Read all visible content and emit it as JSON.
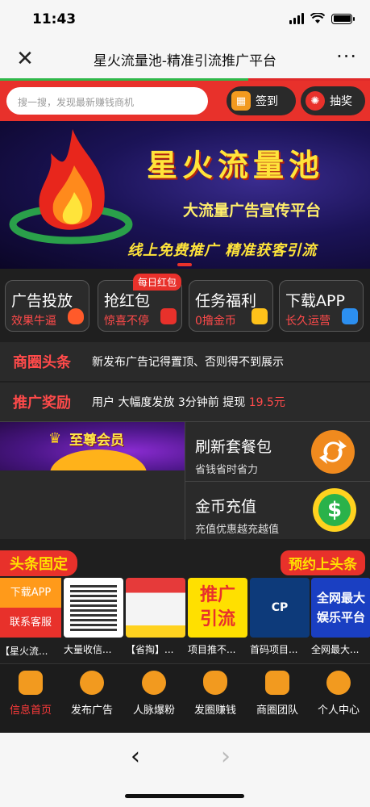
{
  "status": {
    "time": "11:43"
  },
  "nav": {
    "title": "星火流量池-精准引流推广平台",
    "close": "✕",
    "more": "···"
  },
  "page_load_progress": 0.67,
  "search": {
    "placeholder": "搜一搜，发现最新赚钱商机"
  },
  "actions": {
    "signin": "签到",
    "lottery": "抽奖"
  },
  "banner": {
    "title": "星火流量池",
    "subtitle": "大流量广告宣传平台",
    "slogan": "线上免费推广 精准获客引流"
  },
  "quick": {
    "badge": "每日红包",
    "items": [
      {
        "title": "广告投放",
        "sub": "效果牛逼"
      },
      {
        "title": "抢红包",
        "sub": "惊喜不停"
      },
      {
        "title": "任务福利",
        "sub": "0撸金币"
      },
      {
        "title": "下载APP",
        "sub": "长久运营"
      }
    ]
  },
  "headline": {
    "label": "商圈头条",
    "text": "新发布广告记得置顶、否则得不到展示"
  },
  "reward": {
    "label": "推广奖励",
    "text": "用户 大幅度发放 3分钟前 提现",
    "amount": "19.5元"
  },
  "promo": {
    "vip": "至尊会员",
    "refresh": {
      "title": "刷新套餐包",
      "sub": "省钱省时省力"
    },
    "coins": {
      "title": "金币充值",
      "sub": "充值优惠越充越值",
      "icon_text": "$"
    }
  },
  "section": {
    "left": "头条固定",
    "right": "预约上头条"
  },
  "side": {
    "download": "下载APP",
    "service": "联系客服"
  },
  "ads": [
    {
      "cap": "【星火流...",
      "img_text": ""
    },
    {
      "cap": "大量收信...",
      "img_text": ""
    },
    {
      "cap": "【省掏】...",
      "img_text": ""
    },
    {
      "cap": "项目推不...",
      "img_text": "推广引流"
    },
    {
      "cap": "首码项目...",
      "img_text": "CP"
    },
    {
      "cap": "全网最大...",
      "img_text": "全网最大娱乐平台"
    }
  ],
  "tabs": [
    {
      "label": "信息首页",
      "icon": "shop-icon"
    },
    {
      "label": "发布广告",
      "icon": "send-icon"
    },
    {
      "label": "人脉爆粉",
      "icon": "recycle-icon"
    },
    {
      "label": "发圈赚钱",
      "icon": "money-bag-icon"
    },
    {
      "label": "商圈团队",
      "icon": "team-icon"
    },
    {
      "label": "个人中心",
      "icon": "user-icon"
    }
  ],
  "browser": {
    "back": "‹",
    "forward": "›"
  }
}
